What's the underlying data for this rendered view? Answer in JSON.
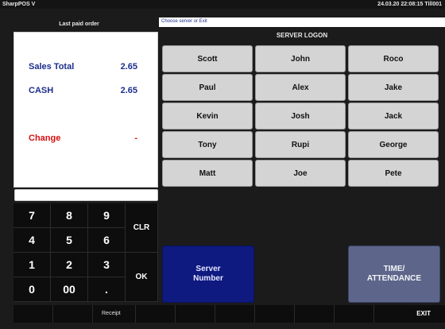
{
  "titlebar": {
    "app": "SharpPOS V",
    "datetime": "24.03.20  22:08:15 Till001"
  },
  "left_panel": {
    "header": "Last paid order",
    "sales_total_label": "Sales Total",
    "sales_total_value": "2.65",
    "cash_label": "CASH",
    "cash_value": "2.65",
    "change_label": "Change",
    "change_value": "-"
  },
  "entry": {
    "value": ""
  },
  "keypad": {
    "k7": "7",
    "k8": "8",
    "k9": "9",
    "k4": "4",
    "k5": "5",
    "k6": "6",
    "k1": "1",
    "k2": "2",
    "k3": "3",
    "k0": "0",
    "k00": "00",
    "kdot": ".",
    "clr": "CLR",
    "ok": "OK"
  },
  "prompt": "Choose server or Exit",
  "server_panel": {
    "heading": "SERVER LOGON",
    "servers": [
      "Scott",
      "John",
      "Roco",
      "Paul",
      "Alex",
      "Jake",
      "Kevin",
      "Josh",
      "Jack",
      "Tony",
      "Rupi",
      "George",
      "Matt",
      "Joe",
      "Pete"
    ],
    "server_number_label": "Server\nNumber",
    "time_attendance_label": "TIME/\nATTENDANCE"
  },
  "footer": {
    "receipt": "Receipt",
    "exit": "EXIT"
  },
  "colors": {
    "background": "#1b1b1b",
    "server_button": "#d4d4d4",
    "server_number": "#0e1a80",
    "time_attendance": "#5d668a",
    "text_navy": "#1c2e8c",
    "text_red": "#d40f0f"
  }
}
